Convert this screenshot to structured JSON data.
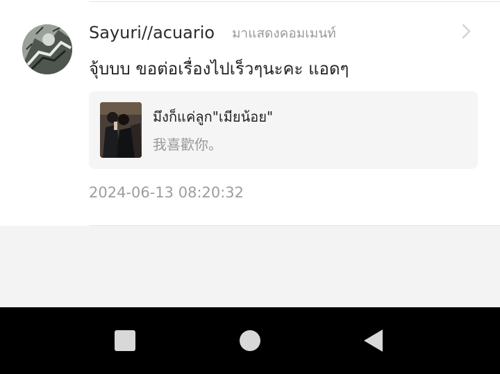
{
  "comment": {
    "username": "Sayuri//acuario",
    "action": "มาแสดงคอมเมนท์",
    "text": "จุ้บบบ ขอต่อเรื่องไปเร็วๆนะคะ แอดๆ",
    "timestamp": "2024-06-13 08:20:32"
  },
  "quote": {
    "title": "มึงก็แค่ลูก\"เมียน้อย\"",
    "subtitle": "我喜歡你。"
  },
  "icons": {
    "avatar": "avatar",
    "chevron": "chevron-right-icon",
    "nav_recents": "square-icon",
    "nav_home": "circle-icon",
    "nav_back": "triangle-back-icon"
  },
  "colors": {
    "quote_background": "#f5f5f5",
    "nav_background": "#000000",
    "nav_icon": "#d8d8d8",
    "secondary_text": "#9a9a9a"
  }
}
